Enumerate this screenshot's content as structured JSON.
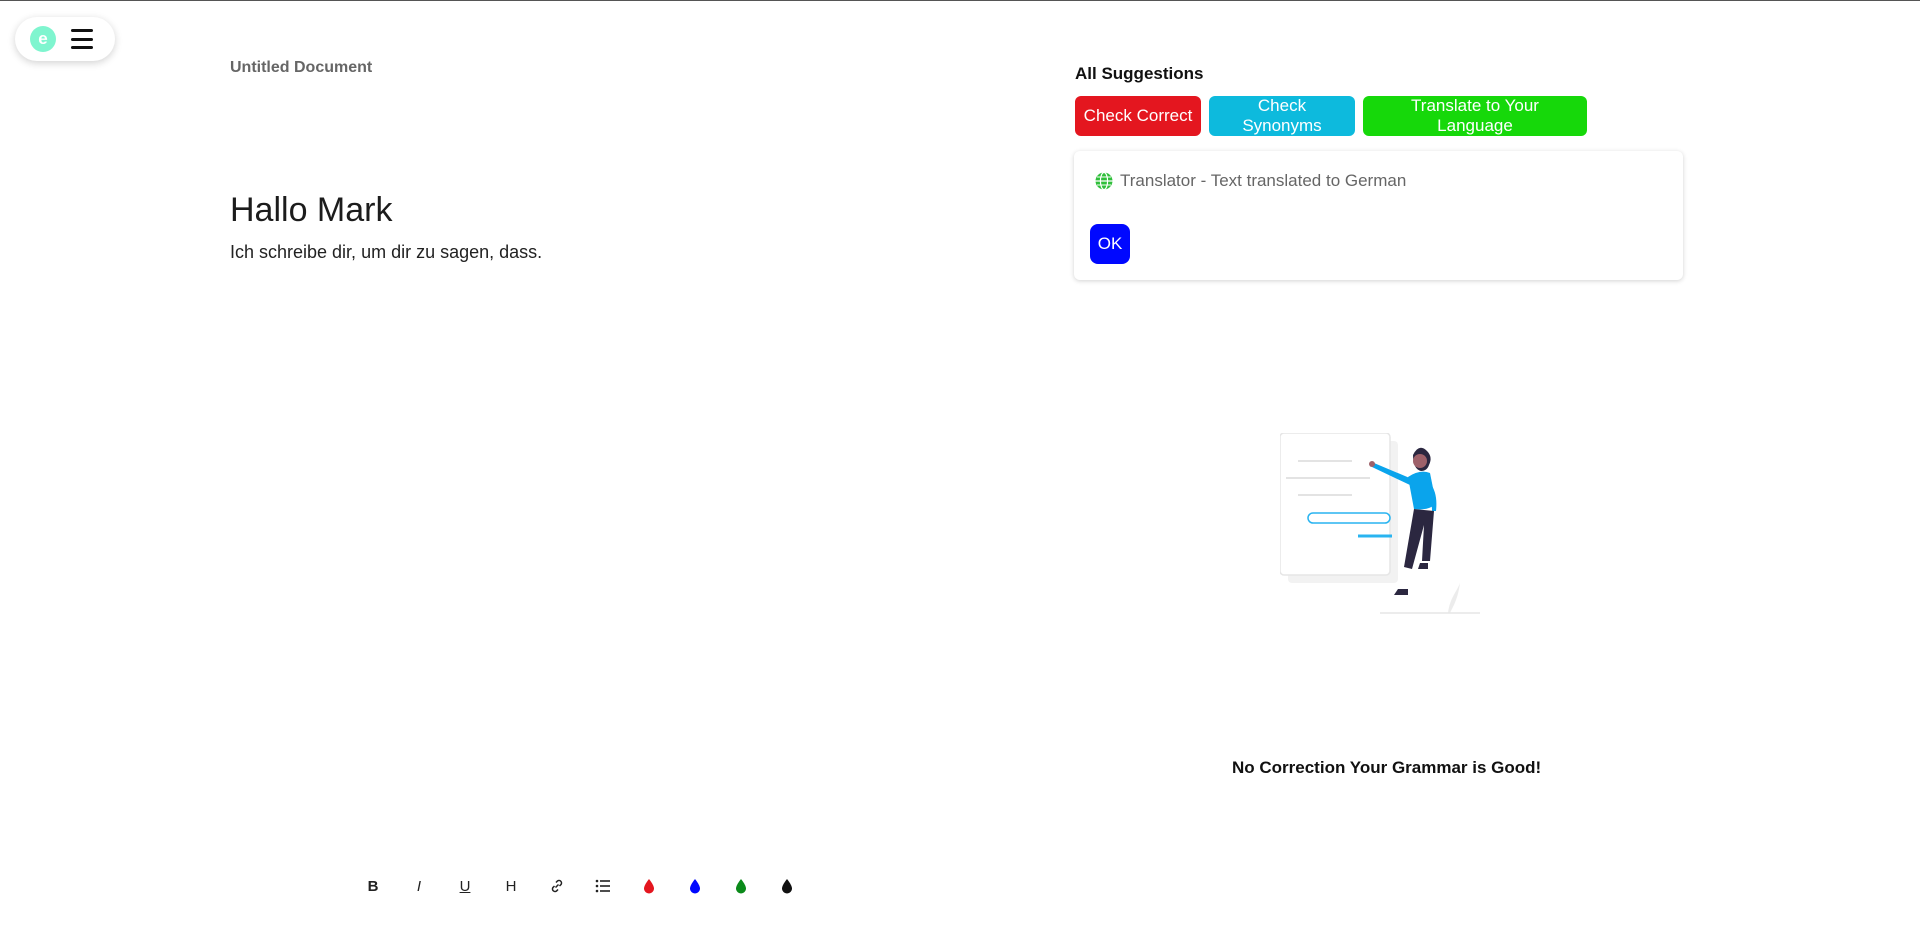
{
  "app": {
    "logo_letter": "e",
    "menu_icon": "hamburger-icon"
  },
  "document": {
    "title": "Untitled Document",
    "heading": "Hallo Mark",
    "body": "Ich schreibe dir, um dir zu sagen, dass."
  },
  "toolbar": {
    "items": [
      {
        "name": "bold",
        "label": "B"
      },
      {
        "name": "italic",
        "label": "I"
      },
      {
        "name": "underline",
        "label": "U"
      },
      {
        "name": "heading",
        "label": "H"
      },
      {
        "name": "link",
        "icon": "link-icon"
      },
      {
        "name": "list",
        "icon": "list-icon"
      },
      {
        "name": "color-red",
        "color": "#e4161f"
      },
      {
        "name": "color-blue",
        "color": "#0008ff"
      },
      {
        "name": "color-green",
        "color": "#0b8a1a"
      },
      {
        "name": "color-black",
        "color": "#111111"
      }
    ]
  },
  "suggestions": {
    "title": "All Suggestions",
    "buttons": {
      "check_correct": "Check Correct",
      "check_synonyms": "Check Synonyms",
      "translate": "Translate to Your Language"
    },
    "colors": {
      "check_correct": "#e4161f",
      "check_synonyms": "#0dbadd",
      "translate": "#16d80a"
    },
    "translator_card": {
      "icon": "globe-icon",
      "text": "Translator - Text translated to German",
      "ok_label": "OK"
    },
    "status_message": "No Correction Your Grammar is Good!"
  }
}
